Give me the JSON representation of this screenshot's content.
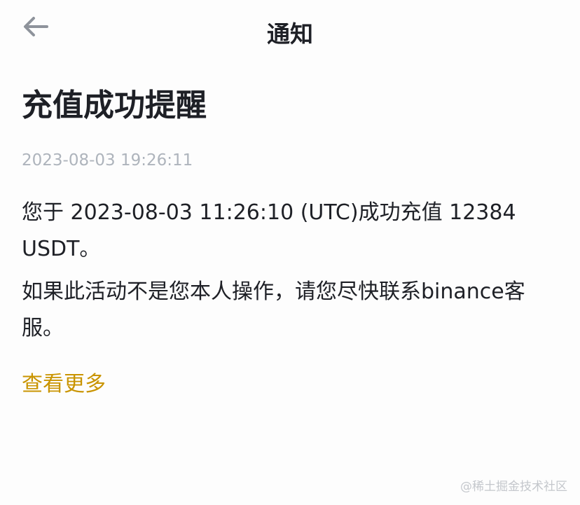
{
  "header": {
    "title": "通知",
    "back_icon": "back-arrow-icon"
  },
  "notice": {
    "title": "充值成功提醒",
    "timestamp": "2023-08-03 19:26:11",
    "paragraphs": [
      "您于 2023-08-03 11:26:10 (UTC)成功充值 12384 USDT。",
      "如果此活动不是您本人操作，请您尽快联系binance客服。"
    ],
    "more_link": "查看更多"
  },
  "watermark": "@稀土掘金技术社区",
  "colors": {
    "text_primary": "#1e2026",
    "text_secondary": "#aeb4bc",
    "accent_link": "#c99400",
    "icon_gray": "#8e939b"
  }
}
